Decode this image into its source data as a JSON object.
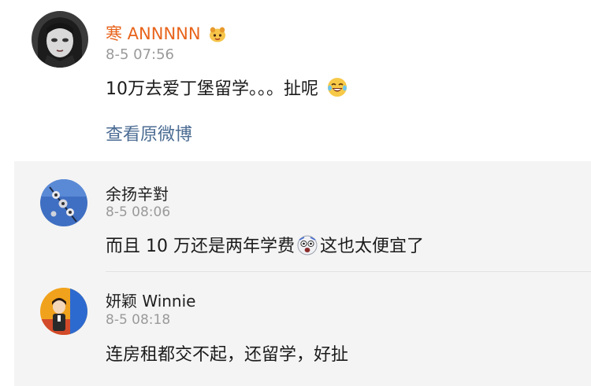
{
  "post": {
    "username": "寒 ANNNNN",
    "username_badge_icon": "cute-face-badge-icon",
    "time": "8-5 07:56",
    "text": "10万去爱丁堡留学。。。扯呢",
    "text_emoji_icon": "laughing-tears-emoji-icon",
    "view_link": "查看原微博",
    "link_color": "#4b6c93",
    "username_color": "#e8641c"
  },
  "replies": [
    {
      "username": "余扬辛對",
      "time": "8-5 08:06",
      "text_before": "而且 10 万还是两年学费",
      "emoji_icon": "shocked-face-emoji-icon",
      "text_after": "这也太便宜了"
    },
    {
      "username": "妍颖 Winnie",
      "time": "8-5 08:18",
      "text": "连房租都交不起，还留学，好扯"
    }
  ]
}
